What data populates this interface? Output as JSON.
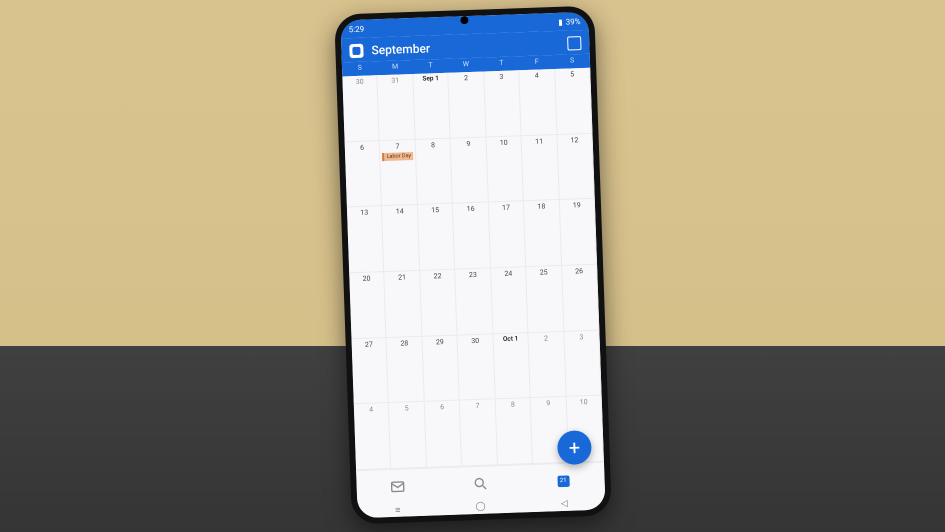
{
  "status": {
    "time": "5:29",
    "battery": "39%"
  },
  "header": {
    "month": "September"
  },
  "weekdays": [
    "S",
    "M",
    "T",
    "W",
    "T",
    "F",
    "S"
  ],
  "weeks": [
    [
      {
        "d": "30",
        "in": false
      },
      {
        "d": "31",
        "in": false
      },
      {
        "d": "Sep 1",
        "in": true,
        "bold": true
      },
      {
        "d": "2",
        "in": true
      },
      {
        "d": "3",
        "in": true
      },
      {
        "d": "4",
        "in": true
      },
      {
        "d": "5",
        "in": true
      }
    ],
    [
      {
        "d": "6",
        "in": true
      },
      {
        "d": "7",
        "in": true,
        "events": [
          "Labor Day"
        ]
      },
      {
        "d": "8",
        "in": true
      },
      {
        "d": "9",
        "in": true
      },
      {
        "d": "10",
        "in": true
      },
      {
        "d": "11",
        "in": true
      },
      {
        "d": "12",
        "in": true
      }
    ],
    [
      {
        "d": "13",
        "in": true
      },
      {
        "d": "14",
        "in": true
      },
      {
        "d": "15",
        "in": true
      },
      {
        "d": "16",
        "in": true
      },
      {
        "d": "17",
        "in": true
      },
      {
        "d": "18",
        "in": true
      },
      {
        "d": "19",
        "in": true
      }
    ],
    [
      {
        "d": "20",
        "in": true
      },
      {
        "d": "21",
        "in": true
      },
      {
        "d": "22",
        "in": true
      },
      {
        "d": "23",
        "in": true
      },
      {
        "d": "24",
        "in": true
      },
      {
        "d": "25",
        "in": true
      },
      {
        "d": "26",
        "in": true
      }
    ],
    [
      {
        "d": "27",
        "in": true
      },
      {
        "d": "28",
        "in": true
      },
      {
        "d": "29",
        "in": true
      },
      {
        "d": "30",
        "in": true
      },
      {
        "d": "Oct 1",
        "in": false,
        "bold": true
      },
      {
        "d": "2",
        "in": false
      },
      {
        "d": "3",
        "in": false
      }
    ],
    [
      {
        "d": "4",
        "in": false
      },
      {
        "d": "5",
        "in": false
      },
      {
        "d": "6",
        "in": false
      },
      {
        "d": "7",
        "in": false
      },
      {
        "d": "8",
        "in": false
      },
      {
        "d": "9",
        "in": false
      },
      {
        "d": "10",
        "in": false
      }
    ]
  ],
  "bottom_nav": {
    "calendar_badge": "21"
  },
  "fab": {
    "label": "+"
  }
}
